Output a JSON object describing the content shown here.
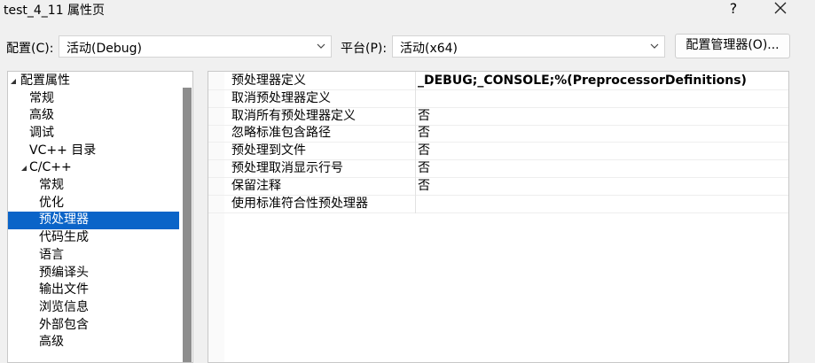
{
  "window": {
    "title": "test_4_11 属性页",
    "help_label": "?",
    "close_icon": "close-icon"
  },
  "config": {
    "configuration_label": "配置(C):",
    "configuration_value": "活动(Debug)",
    "platform_label": "平台(P):",
    "platform_value": "活动(x64)",
    "manager_button": "配置管理器(O)..."
  },
  "tree": {
    "items": [
      {
        "label": "配置属性",
        "arrow": "expanded"
      },
      {
        "label": "常规"
      },
      {
        "label": "高级"
      },
      {
        "label": "调试"
      },
      {
        "label": "VC++ 目录"
      },
      {
        "label": "C/C++",
        "arrow": "expanded"
      },
      {
        "label": "常规"
      },
      {
        "label": "优化"
      },
      {
        "label": "预处理器",
        "selected": true
      },
      {
        "label": "代码生成"
      },
      {
        "label": "语言"
      },
      {
        "label": "预编译头"
      },
      {
        "label": "输出文件"
      },
      {
        "label": "浏览信息"
      },
      {
        "label": "外部包含"
      },
      {
        "label": "高级"
      }
    ]
  },
  "properties": [
    {
      "name": "预处理器定义",
      "value": "_DEBUG;_CONSOLE;%(PreprocessorDefinitions)",
      "bold": true
    },
    {
      "name": "取消预处理器定义",
      "value": ""
    },
    {
      "name": "取消所有预处理器定义",
      "value": "否"
    },
    {
      "name": "忽略标准包含路径",
      "value": "否"
    },
    {
      "name": "预处理到文件",
      "value": "否"
    },
    {
      "name": "预处理取消显示行号",
      "value": "否"
    },
    {
      "name": "保留注释",
      "value": "否"
    },
    {
      "name": "使用标准符合性预处理器",
      "value": ""
    }
  ],
  "colors": {
    "selection": "#0a64c8",
    "window_bg": "#f0f0f0"
  }
}
